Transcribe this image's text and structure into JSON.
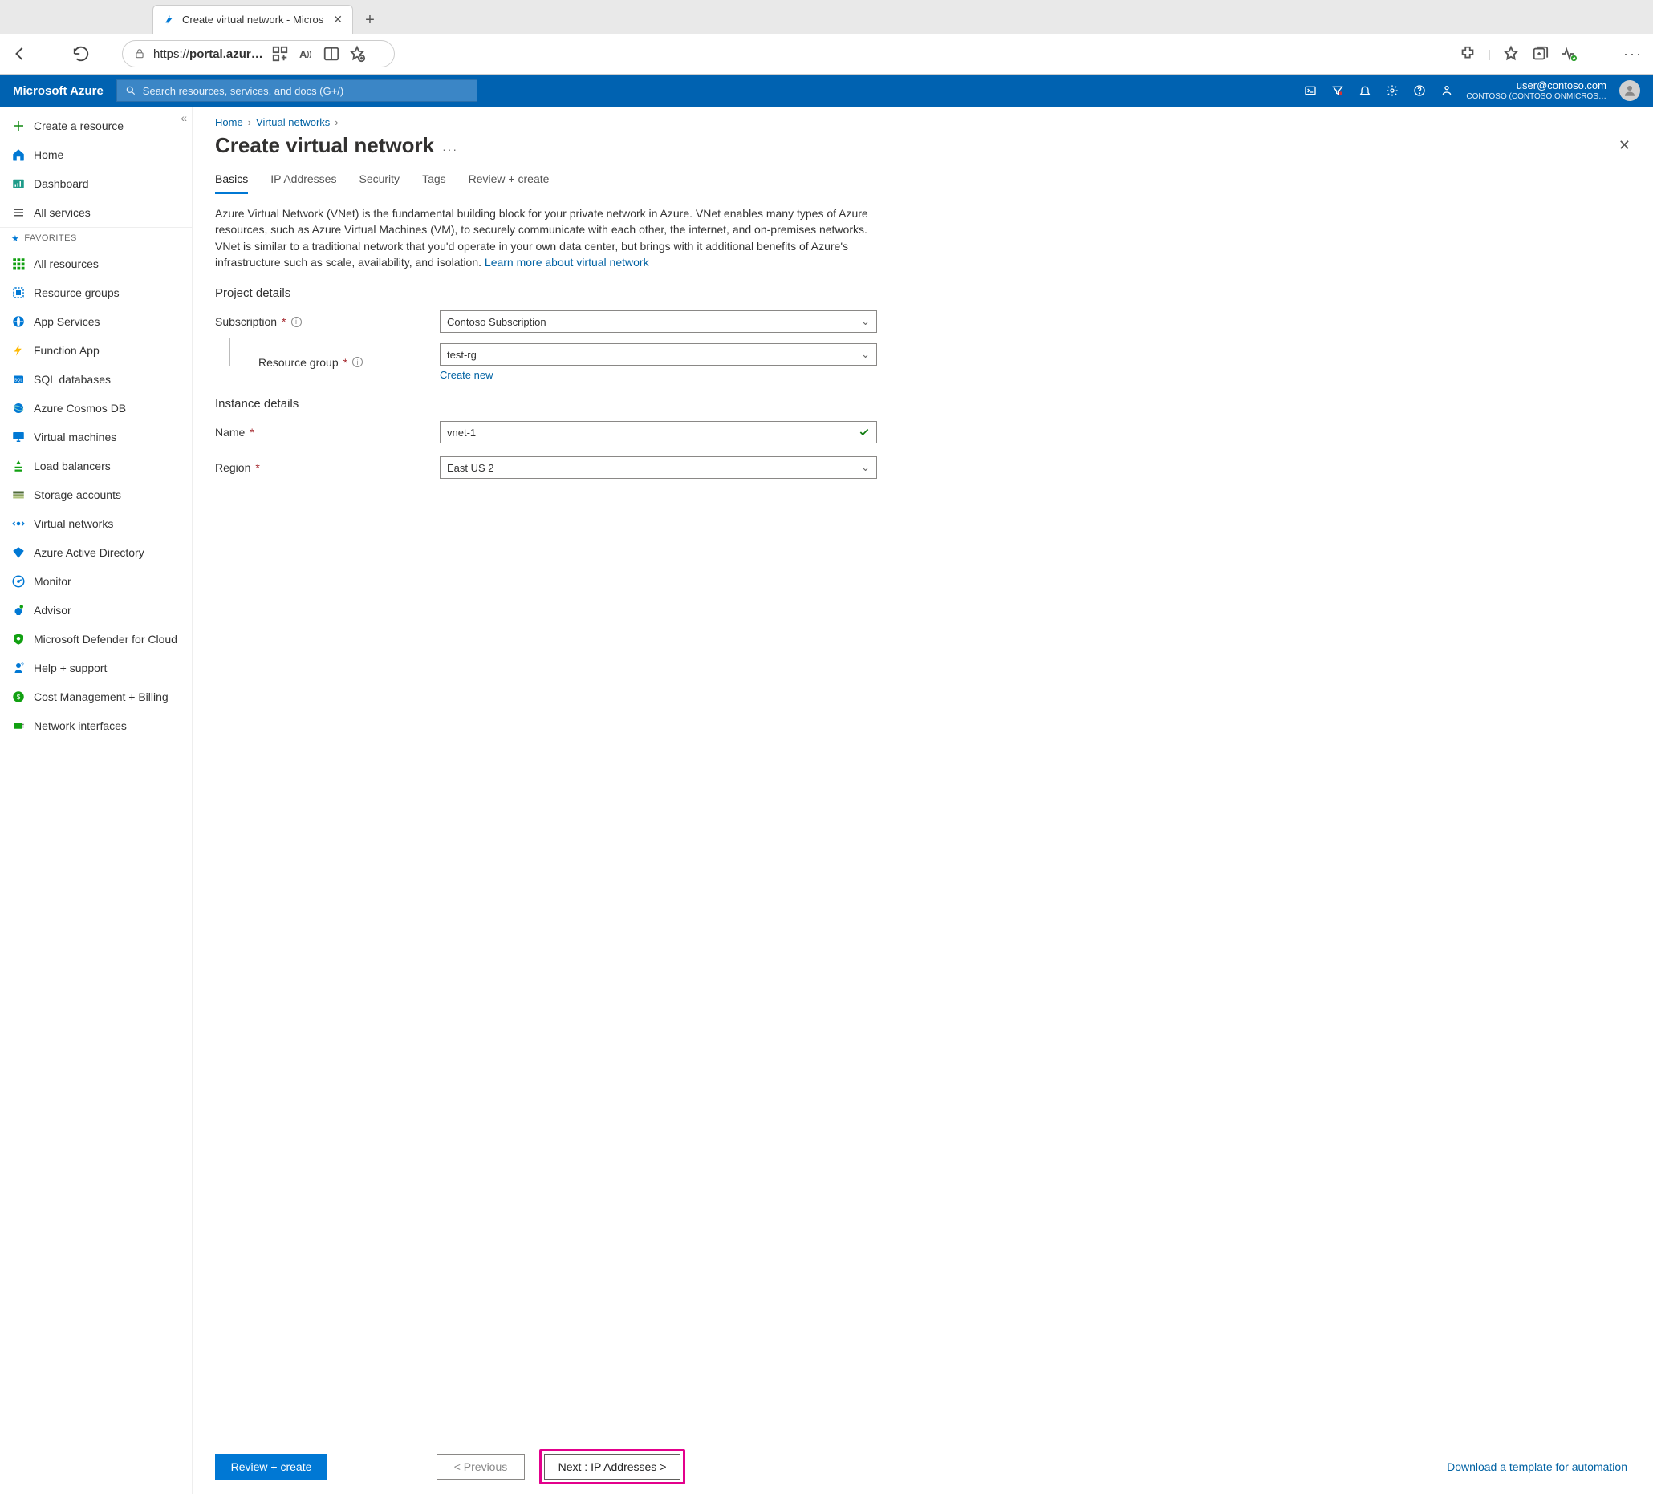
{
  "browser": {
    "tab_title": "Create virtual network - Micros",
    "url_prefix": "https://",
    "url_host": "portal.azur…"
  },
  "header": {
    "brand": "Microsoft Azure",
    "search_placeholder": "Search resources, services, and docs (G+/)",
    "user_email": "user@contoso.com",
    "tenant": "CONTOSO (CONTOSO.ONMICROS…"
  },
  "side_nav": {
    "create": "Create a resource",
    "home": "Home",
    "dashboard": "Dashboard",
    "all_services": "All services",
    "favorites_label": "FAVORITES",
    "items": [
      "All resources",
      "Resource groups",
      "App Services",
      "Function App",
      "SQL databases",
      "Azure Cosmos DB",
      "Virtual machines",
      "Load balancers",
      "Storage accounts",
      "Virtual networks",
      "Azure Active Directory",
      "Monitor",
      "Advisor",
      "Microsoft Defender for Cloud",
      "Help + support",
      "Cost Management + Billing",
      "Network interfaces"
    ]
  },
  "breadcrumb": {
    "home": "Home",
    "vnets": "Virtual networks"
  },
  "page": {
    "title": "Create virtual network",
    "tabs": [
      "Basics",
      "IP Addresses",
      "Security",
      "Tags",
      "Review + create"
    ],
    "active_tab_index": 0,
    "intro": "Azure Virtual Network (VNet) is the fundamental building block for your private network in Azure. VNet enables many types of Azure resources, such as Azure Virtual Machines (VM), to securely communicate with each other, the internet, and on-premises networks. VNet is similar to a traditional network that you'd operate in your own data center, but brings with it additional benefits of Azure's infrastructure such as scale, availability, and isolation.   ",
    "learn_more": "Learn more about virtual network",
    "sections": {
      "project_details": "Project details",
      "instance_details": "Instance details"
    },
    "fields": {
      "subscription_label": "Subscription",
      "subscription_value": "Contoso Subscription",
      "resource_group_label": "Resource group",
      "resource_group_value": "test-rg",
      "create_new": "Create new",
      "name_label": "Name",
      "name_value": "vnet-1",
      "region_label": "Region",
      "region_value": "East US 2"
    }
  },
  "footer": {
    "review": "Review + create",
    "previous": "< Previous",
    "next": "Next : IP Addresses >",
    "download": "Download a template for automation"
  }
}
